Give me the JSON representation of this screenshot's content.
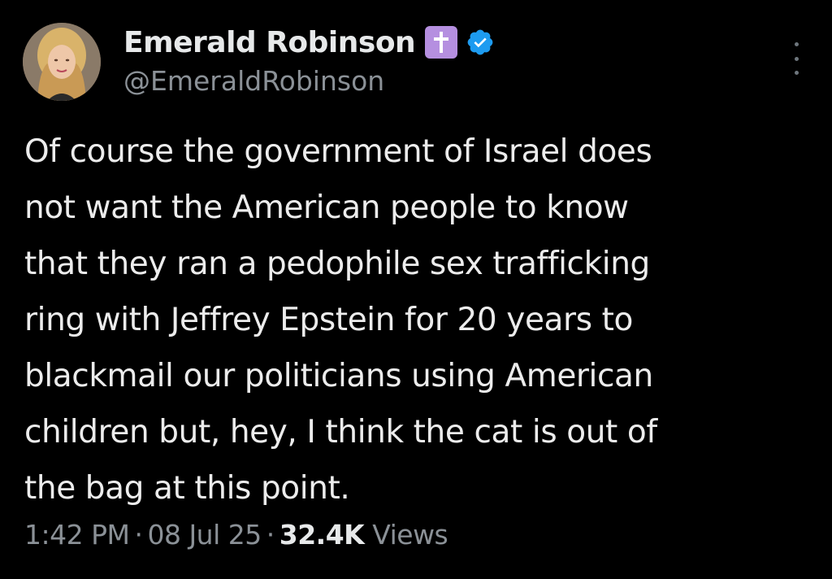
{
  "author": {
    "display_name": "Emerald Robinson",
    "handle": "@EmeraldRobinson",
    "badge_icon": "latin-cross-icon",
    "verified_icon": "verified-badge-icon",
    "badge_color": "#b58fe0",
    "verified_color": "#1d9bf0"
  },
  "tweet": {
    "lines": [
      "Of course the government of Israel does",
      "not want the American people to know",
      "that they ran a pedophile sex trafficking",
      "ring with Jeffrey Epstein for 20 years to",
      "blackmail our politicians using American",
      "children but, hey, I think the cat is out of",
      "the bag at this point."
    ]
  },
  "meta": {
    "time": "1:42 PM",
    "date": "08 Jul 25",
    "views_count": "32.4K",
    "views_label": "Views",
    "separator": "·"
  },
  "colors": {
    "background": "#000000",
    "text": "#e7e9ea",
    "secondary_text": "#8b9197"
  }
}
